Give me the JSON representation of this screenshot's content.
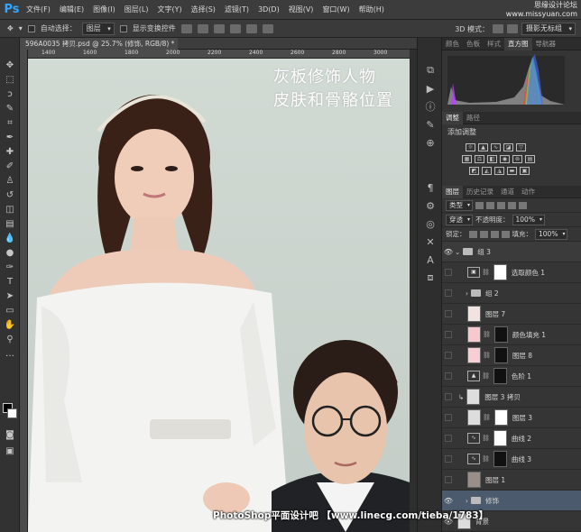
{
  "app": {
    "logo": "Ps"
  },
  "menu": [
    "文件(F)",
    "编辑(E)",
    "图像(I)",
    "图层(L)",
    "文字(Y)",
    "选择(S)",
    "滤镜(T)",
    "3D(D)",
    "视图(V)",
    "窗口(W)",
    "帮助(H)"
  ],
  "top_watermark": {
    "line1": "思缘设计论坛",
    "line2": "www.missyuan.com"
  },
  "options": {
    "auto_select_label": "自动选择：",
    "auto_select_value": "图层",
    "show_transform_label": "显示变换控件",
    "mode_3d_label": "3D 模式：",
    "workspace": "摄影无标组"
  },
  "document": {
    "tab_title": "596A0035 拷贝.psd @ 25.7% (修饰, RGB/8) *",
    "ruler_ticks": [
      "1400",
      "1600",
      "1800",
      "2000",
      "2200",
      "2400",
      "2600",
      "2800",
      "3000"
    ]
  },
  "canvas_text": {
    "line1": "灰板修饰人物",
    "line2": "皮肤和骨骼位置"
  },
  "footer_watermark": "PhotoShop平面设计吧 【www.linecg.com/tieba/1783】",
  "panels": {
    "top_tabs": [
      "颜色",
      "色板",
      "样式",
      "直方图",
      "导航器"
    ],
    "top_active": "直方图",
    "adjust_tabs": [
      "调整",
      "路径"
    ],
    "adjust_title": "添加调整",
    "layer_tabs": [
      "图层",
      "历史记录",
      "通道",
      "动作"
    ],
    "layers_filter": "类型",
    "blend_mode": "穿透",
    "opacity_label": "不透明度：",
    "opacity_value": "100%",
    "lock_label": "锁定：",
    "fill_label": "填充：",
    "fill_value": "100%"
  },
  "layers": [
    {
      "name": "组 3",
      "kind": "group",
      "visible": true
    },
    {
      "name": "选取颜色 1",
      "kind": "adjust",
      "visible": false
    },
    {
      "name": "组 2",
      "kind": "group",
      "visible": false
    },
    {
      "name": "图层 7",
      "kind": "pixel",
      "visible": false
    },
    {
      "name": "颜色填充 1",
      "kind": "fill",
      "visible": false
    },
    {
      "name": "图层 8",
      "kind": "pixel",
      "visible": false
    },
    {
      "name": "色阶 1",
      "kind": "adjust",
      "visible": false
    },
    {
      "name": "图层 3 拷贝",
      "kind": "pixel",
      "visible": false
    },
    {
      "name": "图层 3",
      "kind": "pixel",
      "visible": false
    },
    {
      "name": "曲线 2",
      "kind": "adjust",
      "visible": false
    },
    {
      "name": "曲线 3",
      "kind": "adjust",
      "visible": false
    },
    {
      "name": "图层 1",
      "kind": "pixel",
      "visible": false
    },
    {
      "name": "修饰",
      "kind": "group",
      "visible": true
    },
    {
      "name": "背景",
      "kind": "pixel",
      "visible": true
    }
  ],
  "colors": {
    "accent": "#31a8ff",
    "canvas_bg": "#cdd5cf",
    "selected_layer": "#4b5a6d"
  }
}
